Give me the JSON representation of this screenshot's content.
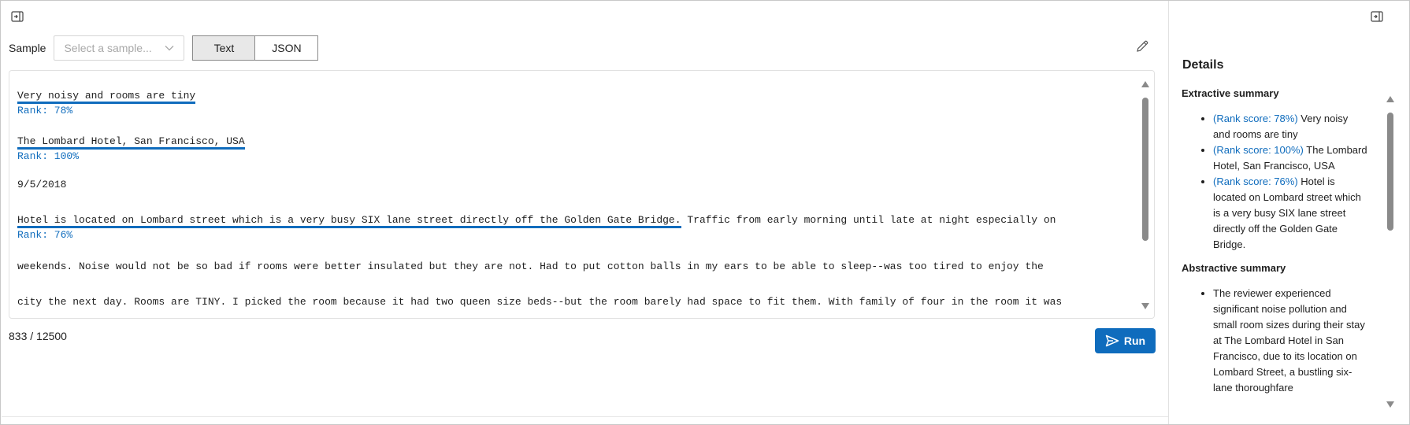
{
  "toolbar": {
    "sample_label": "Sample",
    "sample_placeholder": "Select a sample...",
    "text_tab": "Text",
    "json_tab": "JSON"
  },
  "editor": {
    "lines": [
      {
        "text": "Very noisy and rooms are tiny",
        "underline": true
      },
      {
        "text": "Rank: 78%",
        "rank": true
      },
      {
        "text": "The Lombard Hotel, San Francisco, USA",
        "underline": true
      },
      {
        "text": "Rank: 100%",
        "rank": true
      },
      {
        "text": "9/5/2018"
      },
      {
        "text": "Hotel is located on Lombard street which is a very busy SIX lane street directly off the Golden Gate Bridge.",
        "underline": true,
        "tail": " Traffic from early morning until late at night especially on"
      },
      {
        "text": "Rank: 76%",
        "rank": true
      },
      {
        "text": "weekends. Noise would not be so bad if rooms were better insulated but they are not. Had to put cotton balls in my ears to be able to sleep--was too tired to enjoy the"
      },
      {
        "text": "city the next day. Rooms are TINY. I picked the room because it had two queen size beds--but the room barely had space to fit them. With family of four in the room it was"
      }
    ]
  },
  "char_count": "833 / 12500",
  "run_label": "Run",
  "details": {
    "title": "Details",
    "extractive_title": "Extractive summary",
    "extractive": [
      {
        "rank": "(Rank score: 78%)",
        "text": " Very noisy and rooms are tiny"
      },
      {
        "rank": "(Rank score: 100%)",
        "text": " The Lombard Hotel, San Francisco, USA"
      },
      {
        "rank": "(Rank score: 76%)",
        "text": " Hotel is located on Lombard street which is a very busy SIX lane street directly off the Golden Gate Bridge."
      }
    ],
    "abstractive_title": "Abstractive summary",
    "abstractive": [
      "The reviewer experienced significant noise pollution and small room sizes during their stay at The Lombard Hotel in San Francisco, due to its location on Lombard Street, a bustling six-lane thoroughfare"
    ]
  },
  "colors": {
    "accent": "#0f6cbd"
  }
}
